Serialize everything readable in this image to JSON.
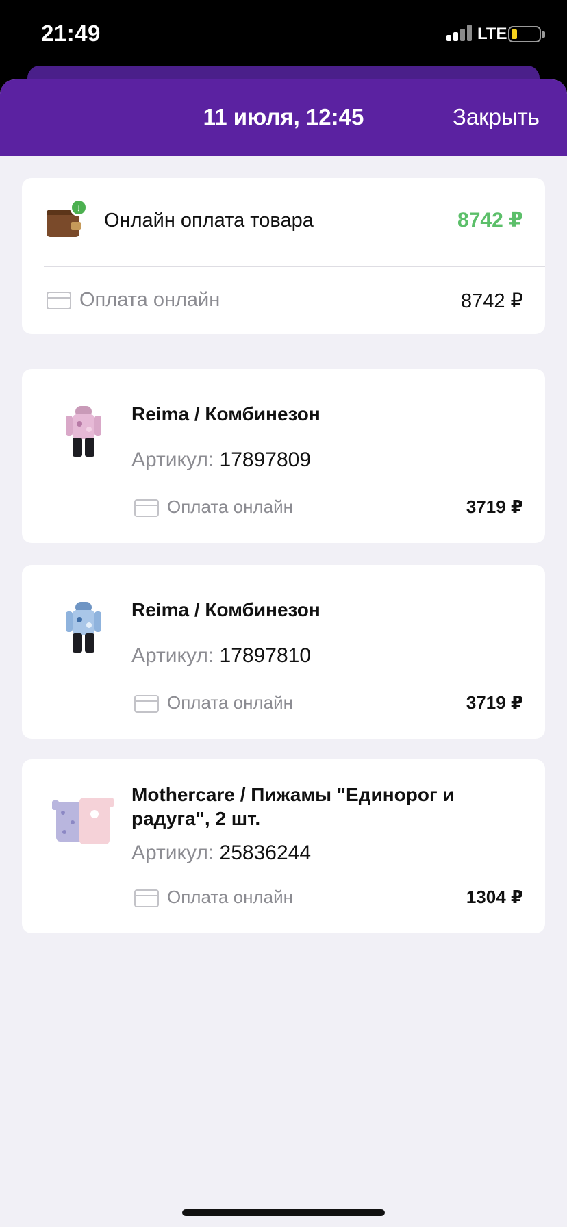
{
  "status_bar": {
    "time": "21:49",
    "network": "LTE"
  },
  "header": {
    "title": "11 июля, 12:45",
    "close_label": "Закрыть"
  },
  "summary": {
    "title": "Онлайн оплата товара",
    "total": "8742 ₽",
    "payment_label": "Оплата онлайн",
    "payment_amount": "8742 ₽"
  },
  "products": [
    {
      "name": "Reima / Комбинезон",
      "article_label": "Артикул:",
      "article": "17897809",
      "payment_label": "Оплата онлайн",
      "price": "3719 ₽"
    },
    {
      "name": "Reima / Комбинезон",
      "article_label": "Артикул:",
      "article": "17897810",
      "payment_label": "Оплата онлайн",
      "price": "3719 ₽"
    },
    {
      "name": "Mothercare / Пижамы \"Единорог и радуга\", 2 шт.",
      "article_label": "Артикул:",
      "article": "25836244",
      "payment_label": "Оплата онлайн",
      "price": "1304 ₽"
    }
  ],
  "colors": {
    "header": "#5b22a1",
    "total": "#5cbf6a",
    "background": "#f1f0f6"
  }
}
